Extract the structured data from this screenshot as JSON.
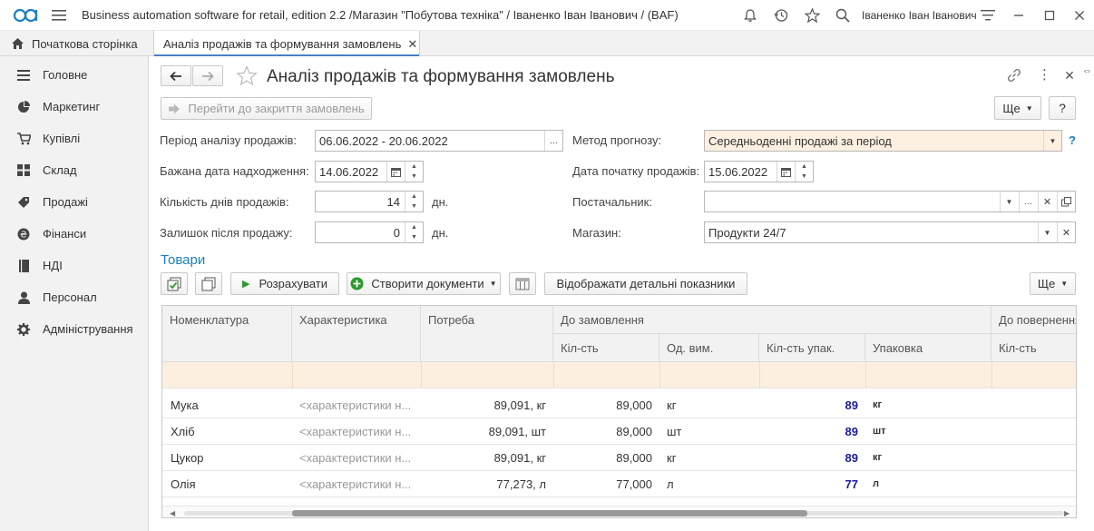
{
  "app": {
    "title": "Business automation software for retail, edition 2.2 /Магазин \"Побутова техніка\" / Іваненко Іван Іванович /  (BAF)",
    "user": "Іваненко Іван Іванович"
  },
  "tabs": {
    "home": "Початкова сторінка",
    "active": "Аналіз продажів та формування замовлень"
  },
  "sidebar": {
    "items": [
      {
        "label": "Головне",
        "icon": "menu-icon"
      },
      {
        "label": "Маркетинг",
        "icon": "pie-chart-icon"
      },
      {
        "label": "Купівлі",
        "icon": "cart-icon"
      },
      {
        "label": "Склад",
        "icon": "warehouse-icon"
      },
      {
        "label": "Продажі",
        "icon": "sales-icon"
      },
      {
        "label": "Фінанси",
        "icon": "finance-icon"
      },
      {
        "label": "НДІ",
        "icon": "book-icon"
      },
      {
        "label": "Персонал",
        "icon": "person-icon"
      },
      {
        "label": "Адміністрування",
        "icon": "gear-icon"
      }
    ]
  },
  "form": {
    "title": "Аналіз продажів та формування замовлень",
    "goto_button": "Перейти до закриття замовлень",
    "more_button": "Ще",
    "help_button": "?",
    "period_label": "Період аналізу продажів:",
    "period_value": "06.06.2022 - 20.06.2022",
    "desired_date_label": "Бажана дата надходження:",
    "desired_date_value": "14.06.2022",
    "days_label": "Кількість днів продажів:",
    "days_value": "14",
    "days_unit": "дн.",
    "remain_label": "Залишок після продажу:",
    "remain_value": "0",
    "remain_unit": "дн.",
    "method_label": "Метод прогнозу:",
    "method_value": "Середньоденні продажі за період",
    "start_date_label": "Дата початку продажів:",
    "start_date_value": "15.06.2022",
    "supplier_label": "Постачальник:",
    "supplier_value": "",
    "store_label": "Магазин:",
    "store_value": "Продукти 24/7"
  },
  "goods": {
    "section_title": "Товари",
    "calc_button": "Розрахувати",
    "create_docs_button": "Створити документи",
    "details_button": "Відображати детальні показники",
    "more_button": "Ще"
  },
  "table": {
    "headers": {
      "nomenclature": "Номенклатура",
      "characteristic": "Характеристика",
      "need": "Потреба",
      "to_order": "До замовлення",
      "qty": "Кіл-сть",
      "unit": "Од. вим.",
      "qty_pack": "Кіл-сть упак.",
      "pack": "Упаковка",
      "to_return": "До повернення",
      "ret_qty": "Кіл-сть"
    },
    "rows": [
      {
        "name": "Мука",
        "char": "<характеристики н...",
        "need": "89,091, кг",
        "qty": "89,000",
        "unit": "кг",
        "qty_pack": "89",
        "pack": "кг"
      },
      {
        "name": "Хліб",
        "char": "<характеристики н...",
        "need": "89,091, шт",
        "qty": "89,000",
        "unit": "шт",
        "qty_pack": "89",
        "pack": "шт"
      },
      {
        "name": "Цукор",
        "char": "<характеристики н...",
        "need": "89,091, кг",
        "qty": "89,000",
        "unit": "кг",
        "qty_pack": "89",
        "pack": "кг"
      },
      {
        "name": "Олія",
        "char": "<характеристики н...",
        "need": "77,273, л",
        "qty": "77,000",
        "unit": "л",
        "qty_pack": "77",
        "pack": "л"
      }
    ]
  },
  "colors": {
    "accent": "#4a7fc1",
    "highlight_row": "#fcefdf",
    "method_field": "#fdf0e0",
    "qty_pack_blue": "#1a1aa6"
  }
}
